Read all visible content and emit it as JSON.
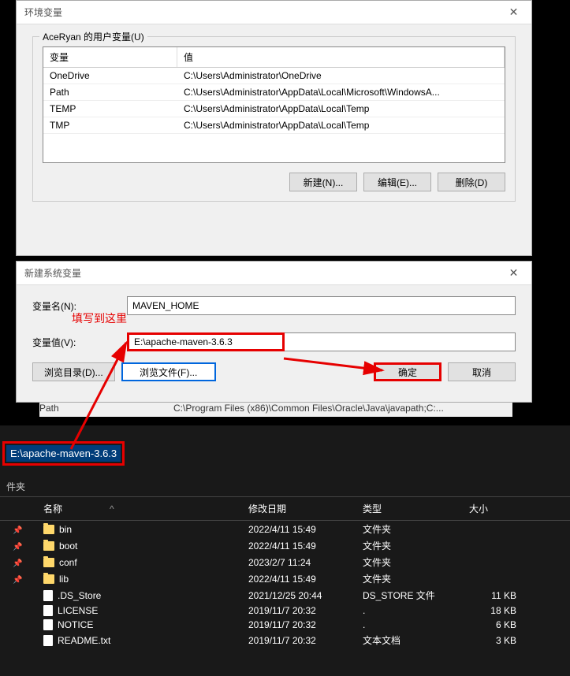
{
  "env_dialog": {
    "title": "环境变量",
    "group_label": "AceRyan 的用户变量(U)",
    "columns": {
      "name": "变量",
      "value": "值"
    },
    "rows": [
      {
        "name": "OneDrive",
        "value": "C:\\Users\\Administrator\\OneDrive"
      },
      {
        "name": "Path",
        "value": "C:\\Users\\Administrator\\AppData\\Local\\Microsoft\\WindowsA..."
      },
      {
        "name": "TEMP",
        "value": "C:\\Users\\Administrator\\AppData\\Local\\Temp"
      },
      {
        "name": "TMP",
        "value": "C:\\Users\\Administrator\\AppData\\Local\\Temp"
      }
    ],
    "buttons": {
      "new": "新建(N)...",
      "edit": "编辑(E)...",
      "delete": "删除(D)"
    }
  },
  "new_var_dialog": {
    "title": "新建系统变量",
    "name_label": "变量名(N):",
    "name_value": "MAVEN_HOME",
    "value_label": "变量值(V):",
    "value_value": "E:\\apache-maven-3.6.3",
    "browse_dir": "浏览目录(D)...",
    "browse_file": "浏览文件(F)...",
    "ok": "确定",
    "cancel": "取消",
    "annotation": "填写到这里"
  },
  "truncated": {
    "name": "Path",
    "value": "C:\\Program Files (x86)\\Common Files\\Oracle\\Java\\javapath;C:..."
  },
  "explorer": {
    "path_value": "E:\\apache-maven-3.6.3",
    "section_label": "件夹",
    "columns": {
      "name": "名称",
      "date": "修改日期",
      "type": "类型",
      "size": "大小"
    },
    "rows": [
      {
        "pin": true,
        "icon": "folder",
        "name": "bin",
        "date": "2022/4/11 15:49",
        "type": "文件夹",
        "size": ""
      },
      {
        "pin": true,
        "icon": "folder",
        "name": "boot",
        "date": "2022/4/11 15:49",
        "type": "文件夹",
        "size": ""
      },
      {
        "pin": true,
        "icon": "folder",
        "name": "conf",
        "date": "2023/2/7 11:24",
        "type": "文件夹",
        "size": ""
      },
      {
        "pin": true,
        "icon": "folder",
        "name": "lib",
        "date": "2022/4/11 15:49",
        "type": "文件夹",
        "size": ""
      },
      {
        "pin": false,
        "icon": "file",
        "name": ".DS_Store",
        "date": "2021/12/25 20:44",
        "type": "DS_STORE 文件",
        "size": "11 KB"
      },
      {
        "pin": false,
        "icon": "file",
        "name": "LICENSE",
        "date": "2019/11/7 20:32",
        "type": ".",
        "size": "18 KB"
      },
      {
        "pin": false,
        "icon": "file",
        "name": "NOTICE",
        "date": "2019/11/7 20:32",
        "type": ".",
        "size": "6 KB"
      },
      {
        "pin": false,
        "icon": "file",
        "name": "README.txt",
        "date": "2019/11/7 20:32",
        "type": "文本文档",
        "size": "3 KB"
      }
    ]
  }
}
